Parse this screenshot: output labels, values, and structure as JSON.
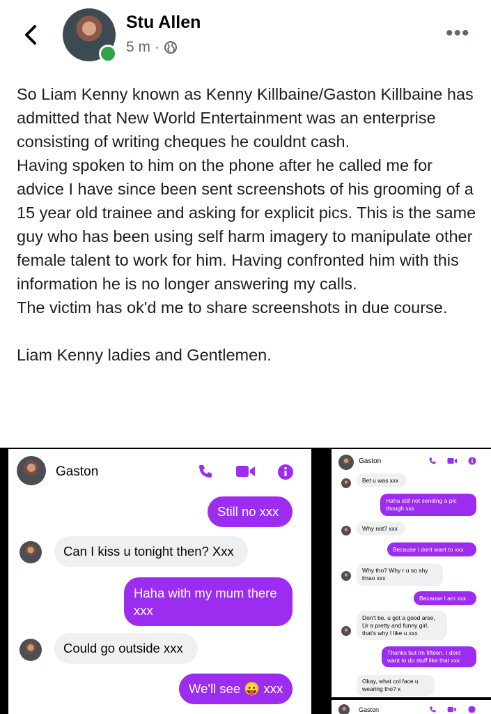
{
  "post_header": {
    "author": "Stu Allen",
    "time": "5 m",
    "separator": "·",
    "privacy_icon": "globe-icon",
    "back_icon": "back-arrow-icon",
    "more_icon": "more-options-icon",
    "more_glyph": "•••"
  },
  "post_body": {
    "paragraphs": [
      "So Liam Kenny known as Kenny Killbaine/Gaston Killbaine has admitted that New World Entertainment was an enterprise consisting of writing cheques he couldnt cash.",
      "Having spoken to him on the phone after he called me for advice I have since been sent screenshots of his grooming of a 15 year old trainee and asking for explicit pics. This is the same guy who has been using self harm imagery to manipulate other female talent to work for him. Having confronted him with this information he is no longer answering my calls.",
      "The victim has ok'd me to share screenshots in due course.",
      "",
      "Liam Kenny ladies and Gentlemen."
    ]
  },
  "screenshot_left": {
    "contact": "Gaston",
    "messages": [
      {
        "dir": "out",
        "text": "Still no xxx"
      },
      {
        "dir": "in",
        "text": "Can I kiss u tonight then? Xxx"
      },
      {
        "dir": "out",
        "text": "Haha with my mum there xxx"
      },
      {
        "dir": "in",
        "text": "Could go outside xxx"
      },
      {
        "dir": "out",
        "text": "We'll see 😛 xxx"
      }
    ]
  },
  "screenshot_right": {
    "contact": "Gaston",
    "messages": [
      {
        "dir": "in",
        "text": "Bet u was xxx"
      },
      {
        "dir": "out",
        "text": "Haha still not sending a pic though xxx"
      },
      {
        "dir": "in",
        "text": "Why not? xxx"
      },
      {
        "dir": "out",
        "text": "Because I dont want to xxx"
      },
      {
        "dir": "in",
        "text": "Why tho? Why r u so shy lmao xxx"
      },
      {
        "dir": "out",
        "text": "Because I am xxx"
      },
      {
        "dir": "in",
        "text": "Don't be, u got a good arse, Ur a pretty and funny girl, that's why I like u xxx"
      },
      {
        "dir": "out",
        "text": "Thanks but Im fifteen. I dont want to do stuff like that xxx"
      },
      {
        "dir": "in",
        "text": "Okay, what col  face u wearing tho?  x"
      }
    ],
    "second_contact": "Gaston"
  },
  "colors": {
    "accent": "#9b2cf0",
    "call_icon": "#9b2cf0",
    "online": "#31a24c"
  }
}
